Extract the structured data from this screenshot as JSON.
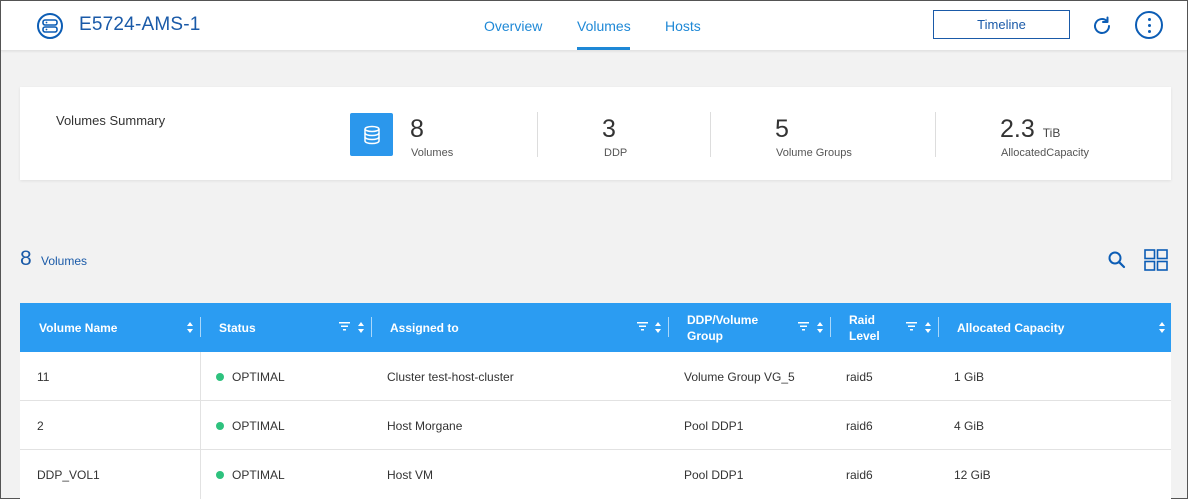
{
  "header": {
    "app_title": "E5724-AMS-1",
    "tabs": [
      {
        "label": "Overview",
        "active": false
      },
      {
        "label": "Volumes",
        "active": true
      },
      {
        "label": "Hosts",
        "active": false
      }
    ],
    "timeline_label": "Timeline",
    "icons": {
      "app": "storage-array-icon",
      "refresh": "refresh-icon",
      "more": "more-vertical-icon"
    }
  },
  "summary": {
    "title": "Volumes Summary",
    "stats": [
      {
        "value": "8",
        "unit": "",
        "label": "Volumes"
      },
      {
        "value": "3",
        "unit": "",
        "label": "DDP"
      },
      {
        "value": "5",
        "unit": "",
        "label": "Volume Groups"
      },
      {
        "value": "2.3",
        "unit": "TiB",
        "label": "AllocatedCapacity"
      }
    ]
  },
  "volumes": {
    "count": "8",
    "count_label": "Volumes",
    "columns": [
      {
        "label": "Volume Name"
      },
      {
        "label": "Status"
      },
      {
        "label": "Assigned to"
      },
      {
        "label": "DDP/Volume Group"
      },
      {
        "label": "Raid Level"
      },
      {
        "label": "Allocated Capacity"
      }
    ],
    "rows": [
      {
        "name": "11",
        "status": "OPTIMAL",
        "assigned": "Cluster test-host-cluster",
        "group": "Volume Group VG_5",
        "raid": "raid5",
        "capacity": "1 GiB"
      },
      {
        "name": "2",
        "status": "OPTIMAL",
        "assigned": "Host Morgane",
        "group": "Pool DDP1",
        "raid": "raid6",
        "capacity": "4 GiB"
      },
      {
        "name": "DDP_VOL1",
        "status": "OPTIMAL",
        "assigned": "Host VM",
        "group": "Pool DDP1",
        "raid": "raid6",
        "capacity": "12 GiB"
      }
    ]
  },
  "colors": {
    "accent": "#2b9cf2",
    "brand": "#1a5aa8",
    "status_optimal": "#2ec27e"
  }
}
